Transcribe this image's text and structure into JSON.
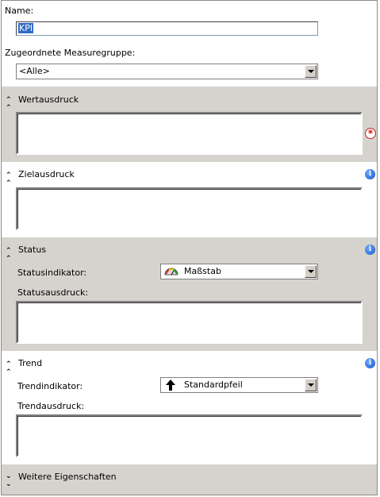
{
  "name": {
    "label": "Name:",
    "value": "KPI"
  },
  "measure_group": {
    "label": "Zugeordnete Measuregruppe:",
    "value": "<Alle>"
  },
  "value_section": {
    "title": "Wertausdruck",
    "collapse_icon": "double-chevron-up"
  },
  "goal_section": {
    "title": "Zielausdruck",
    "collapse_icon": "double-chevron-up"
  },
  "status_section": {
    "title": "Status",
    "indicator_label": "Statusindikator:",
    "indicator_value": "Maßstab",
    "expression_label": "Statusausdruck:"
  },
  "trend_section": {
    "title": "Trend",
    "indicator_label": "Trendindikator:",
    "indicator_value": "Standardpfeil",
    "expression_label": "Trendausdruck:"
  },
  "more_section": {
    "title": "Weitere Eigenschaften",
    "collapse_icon": "double-chevron-down"
  },
  "colors": {
    "panel": "#d6d3ce",
    "info": "#1b55c9",
    "required": "#d01010",
    "selection": "#316ac5"
  }
}
